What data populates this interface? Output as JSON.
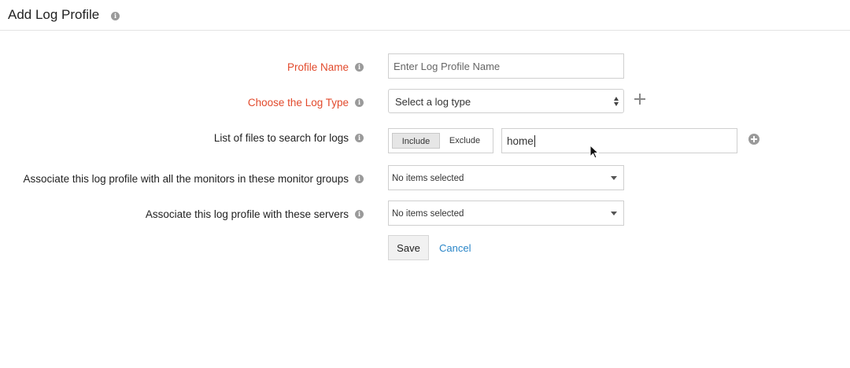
{
  "header": {
    "title": "Add Log Profile",
    "info_icon": "info-icon"
  },
  "form": {
    "profile_name": {
      "label": "Profile Name",
      "placeholder": "Enter Log Profile Name",
      "value": "",
      "required": true
    },
    "log_type": {
      "label": "Choose the Log Type",
      "selected": "Select a log type",
      "required": true,
      "add_icon": "plus-icon"
    },
    "files": {
      "label": "List of files to search for logs",
      "include_label": "Include",
      "exclude_label": "Exclude",
      "active": "Include",
      "value": "home",
      "add_icon": "add-circle-icon"
    },
    "monitor_groups": {
      "label": "Associate this log profile with all the monitors in these monitor groups",
      "selected": "No items selected"
    },
    "servers": {
      "label": "Associate this log profile with these servers",
      "selected": "No items selected"
    }
  },
  "actions": {
    "save_label": "Save",
    "cancel_label": "Cancel"
  },
  "colors": {
    "required_label": "#e24a2c",
    "link": "#2a86c8",
    "border": "#cfcfcf"
  }
}
